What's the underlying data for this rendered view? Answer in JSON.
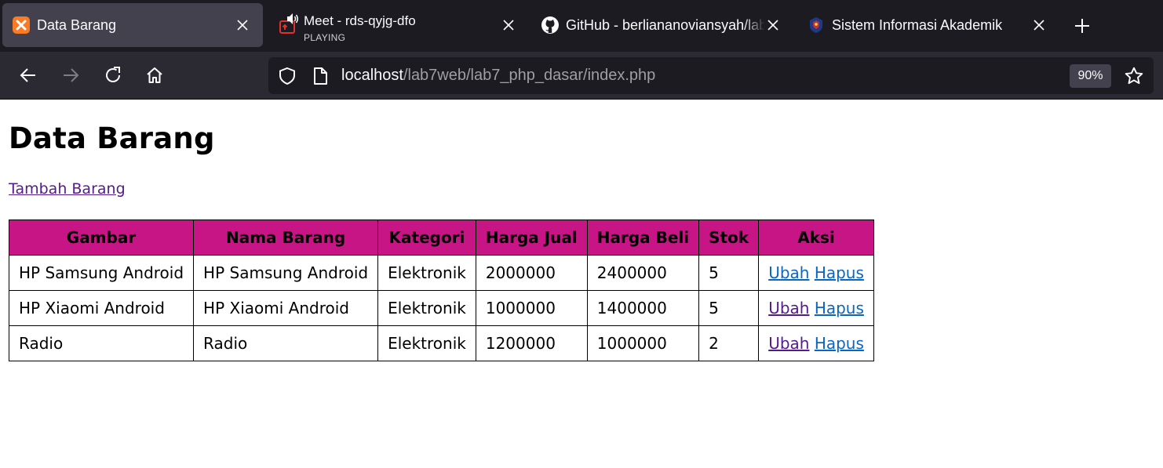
{
  "browser": {
    "tabs": [
      {
        "title": "Data Barang",
        "subtitle": "",
        "active": true,
        "icon": "xampp-icon"
      },
      {
        "title": "Meet - rds-qyjg-dfo",
        "subtitle": "PLAYING",
        "active": false,
        "icon": "meet-icon"
      },
      {
        "title": "GitHub - berliananoviansyah/lab",
        "subtitle": "",
        "active": false,
        "icon": "github-icon"
      },
      {
        "title": "Sistem Informasi Akademik",
        "subtitle": "",
        "active": false,
        "icon": "university-icon"
      }
    ],
    "url_host": "localhost",
    "url_path": "/lab7web/lab7_php_dasar/index.php",
    "zoom": "90%"
  },
  "page": {
    "title": "Data Barang",
    "add_link": "Tambah Barang",
    "columns": [
      "Gambar",
      "Nama Barang",
      "Kategori",
      "Harga Jual",
      "Harga Beli",
      "Stok",
      "Aksi"
    ],
    "rows": [
      {
        "gambar": "HP Samsung Android",
        "nama": "HP Samsung Android",
        "kategori": "Elektronik",
        "harga_jual": "2000000",
        "harga_beli": "2400000",
        "stok": "5",
        "ubah": "Ubah",
        "hapus": "Hapus"
      },
      {
        "gambar": "HP Xiaomi Android",
        "nama": "HP Xiaomi Android",
        "kategori": "Elektronik",
        "harga_jual": "1000000",
        "harga_beli": "1400000",
        "stok": "5",
        "ubah": "Ubah",
        "hapus": "Hapus"
      },
      {
        "gambar": "Radio",
        "nama": "Radio",
        "kategori": "Elektronik",
        "harga_jual": "1200000",
        "harga_beli": "1000000",
        "stok": "2",
        "ubah": "Ubah",
        "hapus": "Hapus"
      }
    ]
  },
  "colors": {
    "header_bg": "#c71585",
    "visited_link": "#551a8b",
    "link": "#0b66c2"
  }
}
